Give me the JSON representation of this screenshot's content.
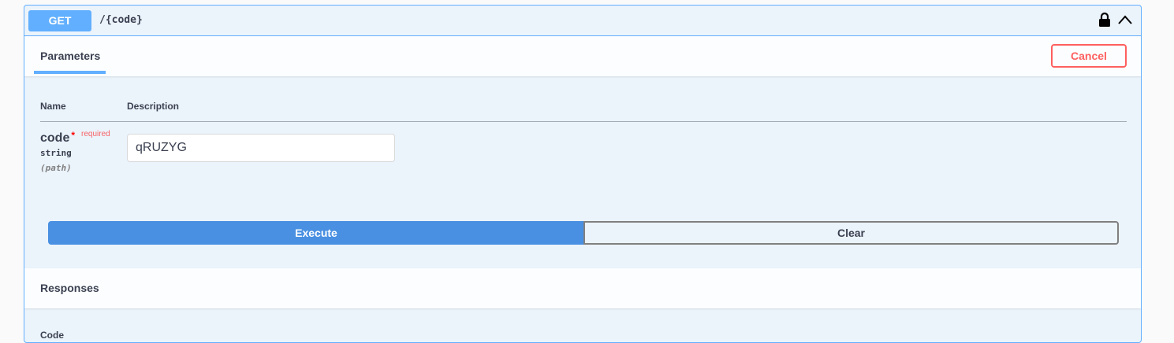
{
  "operation": {
    "method": "GET",
    "path": "/{code}",
    "lock_icon": "lock-icon",
    "toggle_icon": "chevron-up-icon",
    "accent_color": "#61affe"
  },
  "parameters": {
    "tab_label": "Parameters",
    "cancel_label": "Cancel",
    "columns": {
      "name": "Name",
      "description": "Description"
    },
    "items": [
      {
        "name": "code",
        "required_marker": "*",
        "required_label": "required",
        "type": "string",
        "in": "(path)",
        "value": "qRUZYG"
      }
    ]
  },
  "actions": {
    "execute_label": "Execute",
    "clear_label": "Clear",
    "execute_color": "#4990e2"
  },
  "responses": {
    "title": "Responses",
    "code_label": "Code"
  }
}
